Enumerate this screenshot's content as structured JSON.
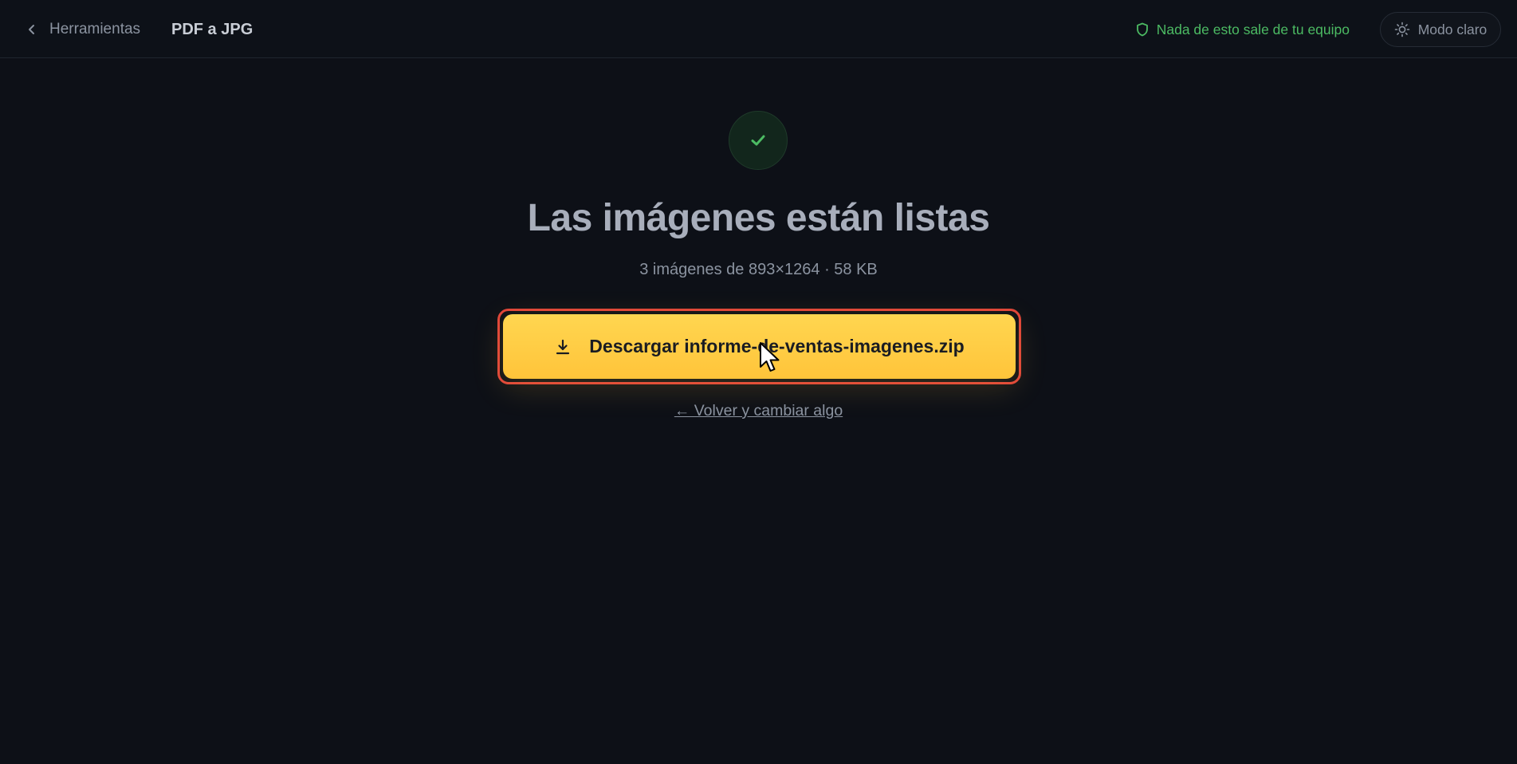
{
  "header": {
    "back_label": "Herramientas",
    "title": "PDF a JPG",
    "privacy_text": "Nada de esto sale de tu equipo",
    "theme_toggle_label": "Modo claro"
  },
  "result": {
    "status_icon": "check-icon",
    "headline": "Las imágenes están listas",
    "summary": "3 imágenes de 893×1264 · 58 KB",
    "download_label": "Descargar informe-de-ventas-imagenes.zip",
    "back_change_label": "← Volver y cambiar algo"
  },
  "colors": {
    "background": "#0d1017",
    "accent": "#ffc43a",
    "success": "#4cbb63",
    "focus_ring": "#e0453a"
  }
}
